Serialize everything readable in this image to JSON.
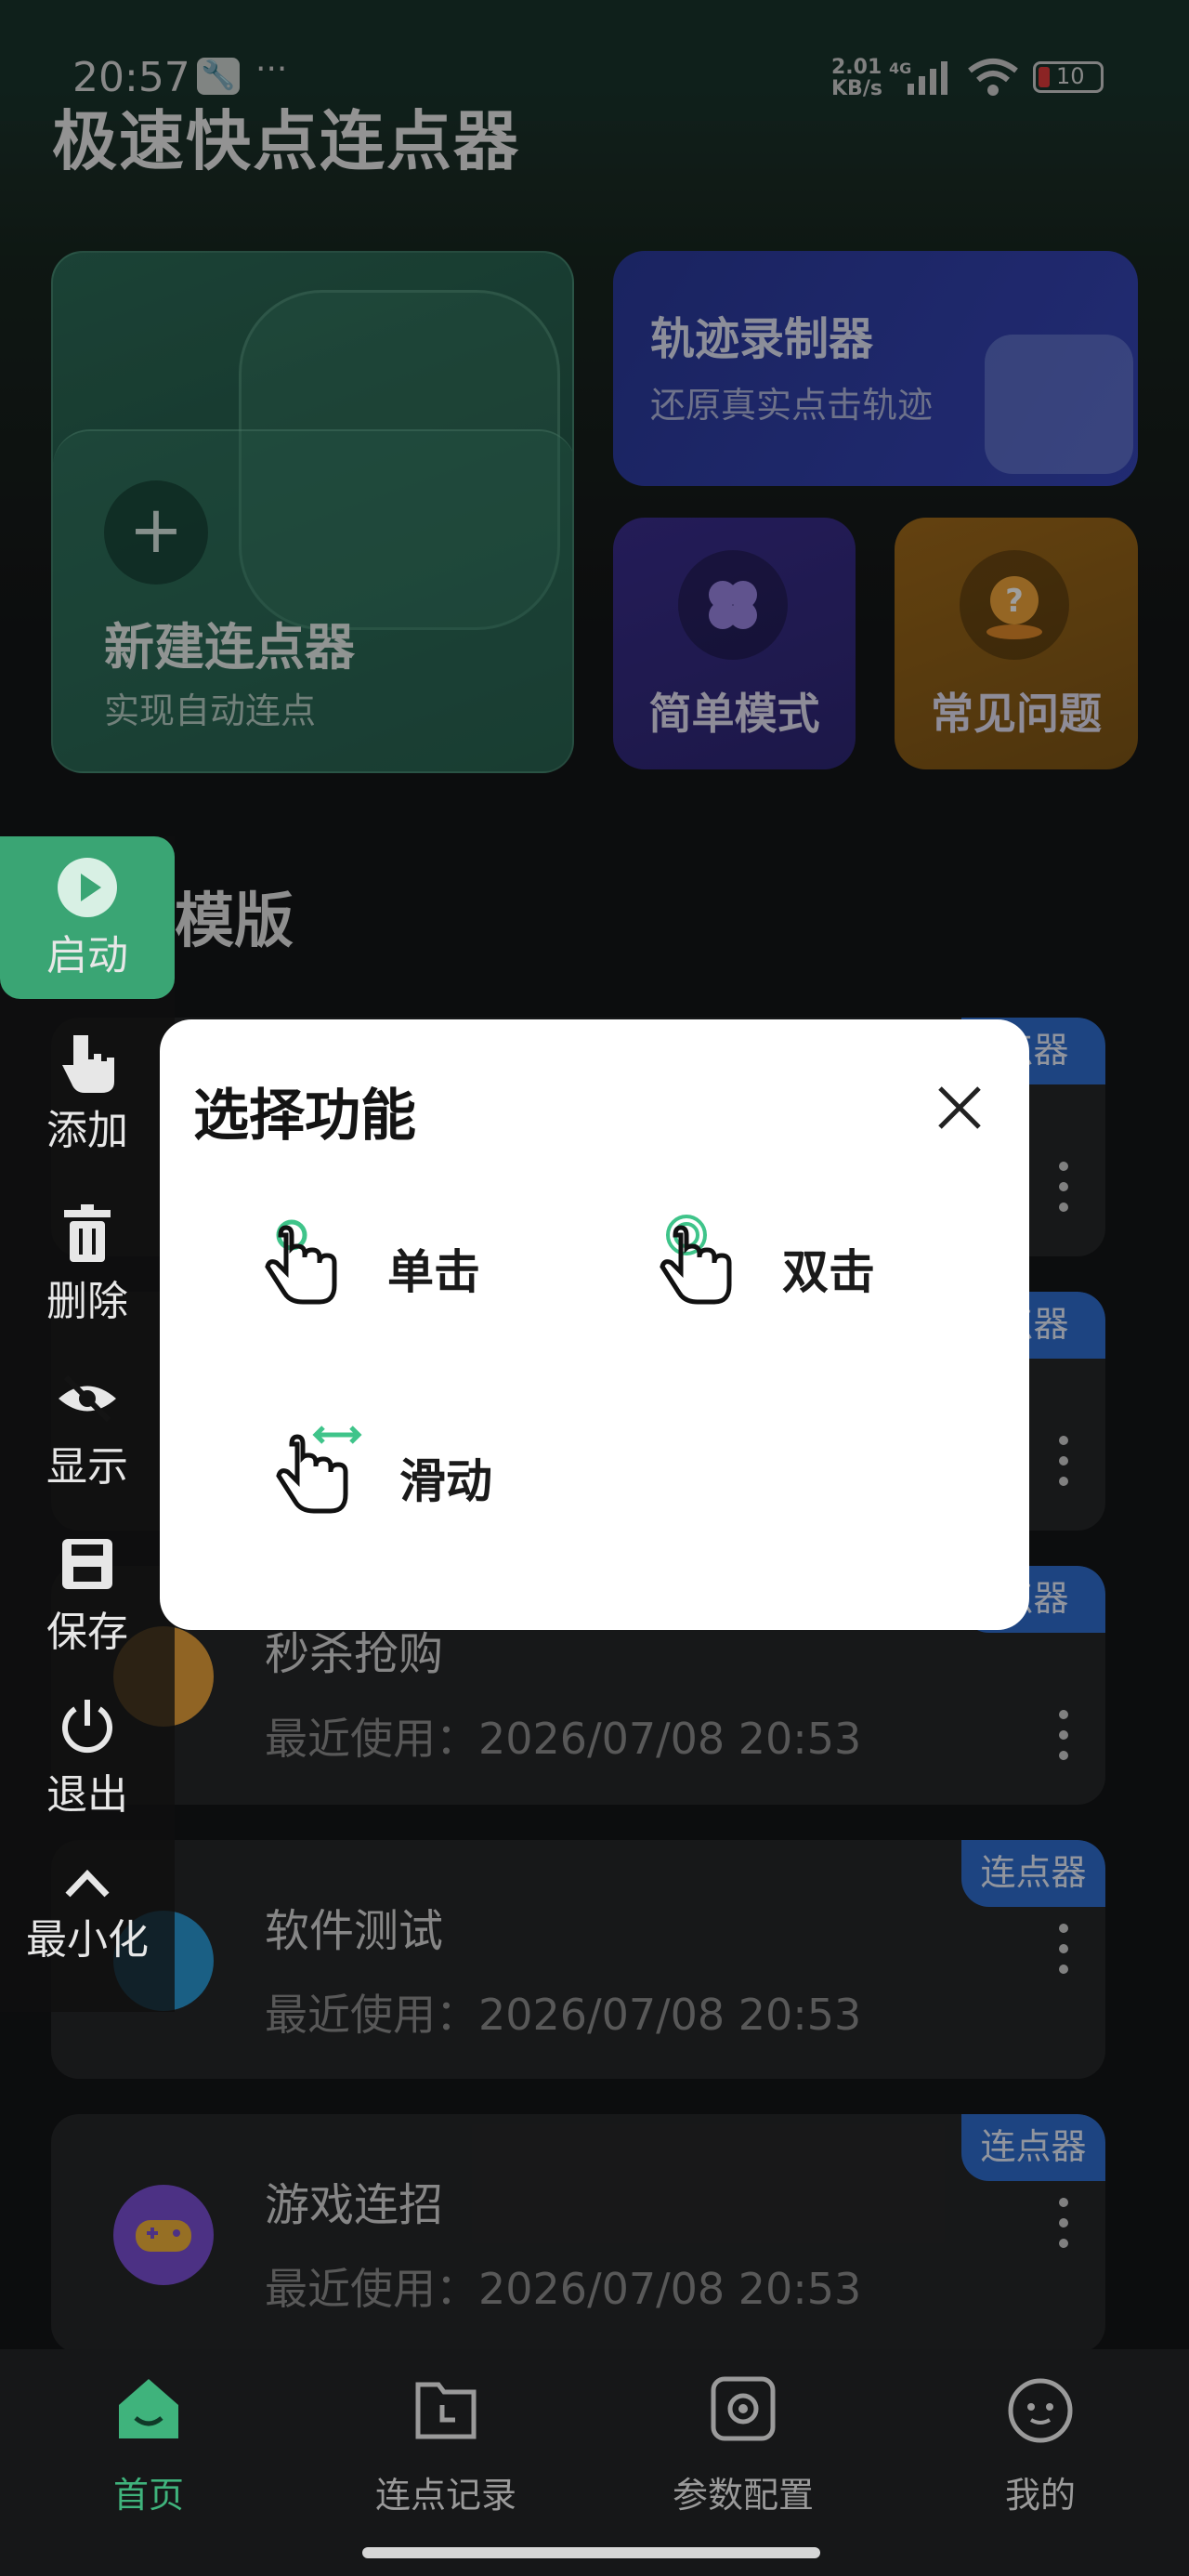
{
  "status_bar": {
    "time": "20:57",
    "dots": "···",
    "net_speed": "2.01",
    "net_unit": "KB/s",
    "net_type": "4G",
    "battery": "10"
  },
  "app": {
    "title": "极速快点连点器"
  },
  "cards": {
    "new_clicker": {
      "title": "新建连点器",
      "subtitle": "实现自动连点"
    },
    "track_recorder": {
      "title": "轨迹录制器",
      "subtitle": "还原真实点击轨迹"
    },
    "simple_mode": {
      "title": "简单模式"
    },
    "faq": {
      "title": "常见问题"
    }
  },
  "section": {
    "title": "模版"
  },
  "templates": [
    {
      "name": "秒杀抢购",
      "meta": "最近使用：2026/07/08 20:53",
      "badge": "连点器",
      "color": "#e8a23a"
    },
    {
      "name": "软件测试",
      "meta": "最近使用：2026/07/08 20:53",
      "badge": "连点器",
      "color": "#2a9ad6"
    },
    {
      "name": "游戏连招",
      "meta": "最近使用：2026/07/08 20:53",
      "badge": "连点器",
      "color": "#7b4fd6"
    }
  ],
  "partial_badges": [
    "点器",
    "点器",
    "点器"
  ],
  "float_panel": {
    "start": "启动",
    "add": "添加",
    "delete": "删除",
    "show": "显示",
    "save": "保存",
    "exit": "退出",
    "minimize": "最小化"
  },
  "dialog": {
    "title": "选择功能",
    "options": {
      "single": "单击",
      "double": "双击",
      "swipe": "滑动"
    }
  },
  "bottom_nav": {
    "items": [
      {
        "label": "首页",
        "active": true
      },
      {
        "label": "连点记录",
        "active": false
      },
      {
        "label": "参数配置",
        "active": false
      },
      {
        "label": "我的",
        "active": false
      }
    ],
    "accent": "#3fb37c"
  }
}
